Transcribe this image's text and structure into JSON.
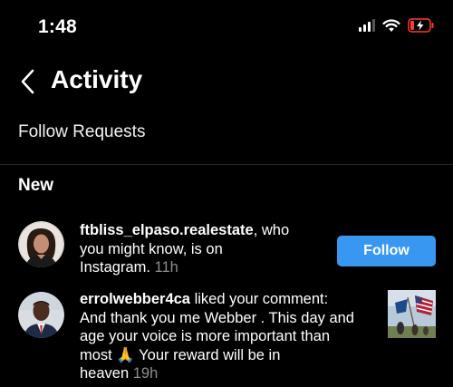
{
  "status_bar": {
    "time": "1:48",
    "signal_icon": "cellular-signal-icon",
    "wifi_icon": "wifi-icon",
    "battery_icon": "battery-low-charging-icon",
    "battery_color": "#ff3b30"
  },
  "header": {
    "back_icon": "chevron-left-icon",
    "title": "Activity"
  },
  "follow_requests_label": "Follow Requests",
  "section_new_label": "New",
  "accent_color": "#3897f0",
  "notifications": [
    {
      "username": "ftbliss_elpaso.realestate",
      "text_line1_rest": ", who",
      "text_line2": "you might know, is on",
      "text_line3": "Instagram.",
      "time": "11h",
      "action_label": "Follow"
    },
    {
      "username": "errolwebber4ca",
      "text_line1_rest": " liked your comment:",
      "text_line2": "And thank you me Webber . This day and",
      "text_line3": "age your voice is more important than",
      "text_line4a": "most ",
      "emoji": "🙏",
      "text_line4b": "  Your reward will be in",
      "text_line5": "heaven",
      "time": "19h"
    }
  ]
}
